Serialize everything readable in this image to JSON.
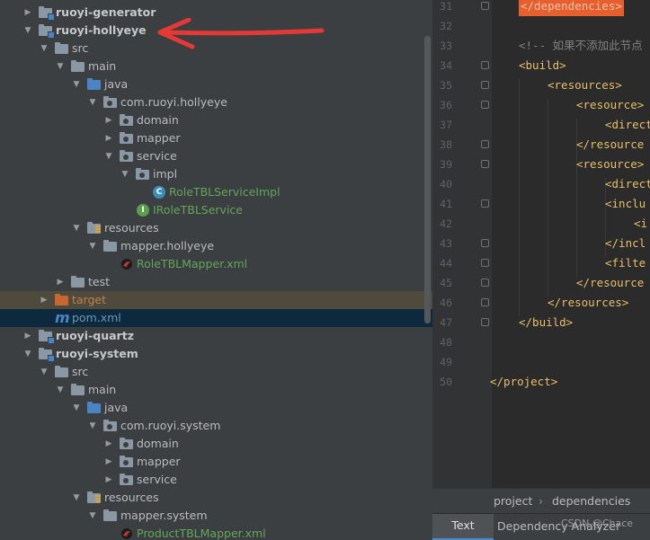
{
  "tree": {
    "rows": [
      {
        "label": "ruoyi-generator",
        "bold": true
      },
      {
        "label": "ruoyi-hollyeye",
        "bold": true
      },
      {
        "label": "src"
      },
      {
        "label": "main"
      },
      {
        "label": "java"
      },
      {
        "label": "com.ruoyi.hollyeye"
      },
      {
        "label": "domain"
      },
      {
        "label": "mapper"
      },
      {
        "label": "service"
      },
      {
        "label": "impl"
      },
      {
        "label": "RoleTBLServiceImpl"
      },
      {
        "label": "IRoleTBLService"
      },
      {
        "label": "resources"
      },
      {
        "label": "mapper.hollyeye"
      },
      {
        "label": "RoleTBLMapper.xml"
      },
      {
        "label": "test"
      },
      {
        "label": "target"
      },
      {
        "label": "pom.xml"
      },
      {
        "label": "ruoyi-quartz",
        "bold": true
      },
      {
        "label": "ruoyi-system",
        "bold": true
      },
      {
        "label": "src"
      },
      {
        "label": "main"
      },
      {
        "label": "java"
      },
      {
        "label": "com.ruoyi.system"
      },
      {
        "label": "domain"
      },
      {
        "label": "mapper"
      },
      {
        "label": "service"
      },
      {
        "label": "resources"
      },
      {
        "label": "mapper.system"
      },
      {
        "label": "ProductTBLMapper.xml"
      }
    ]
  },
  "editor": {
    "lines": [
      {
        "num": "31",
        "text": "</dependencies>"
      },
      {
        "num": "32",
        "text": ""
      },
      {
        "num": "33",
        "text": "<!-- 如果不添加此节点"
      },
      {
        "num": "34",
        "text": "<build>"
      },
      {
        "num": "35",
        "text": "<resources>"
      },
      {
        "num": "36",
        "text": "<resource>"
      },
      {
        "num": "37",
        "text": "<direct"
      },
      {
        "num": "38",
        "text": "</resource"
      },
      {
        "num": "39",
        "text": "<resource>"
      },
      {
        "num": "40",
        "text": "<direct"
      },
      {
        "num": "41",
        "text": "<inclu"
      },
      {
        "num": "42",
        "text": "<i"
      },
      {
        "num": "43",
        "text": "</incl"
      },
      {
        "num": "44",
        "text": "<filte"
      },
      {
        "num": "45",
        "text": "</resource"
      },
      {
        "num": "46",
        "text": "</resources>"
      },
      {
        "num": "47",
        "text": "</build>"
      },
      {
        "num": "48",
        "text": ""
      },
      {
        "num": "49",
        "text": ""
      },
      {
        "num": "50",
        "text": "</project>"
      }
    ]
  },
  "breadcrumb": {
    "first": "project",
    "second": "dependencies"
  },
  "bottom_tabs": {
    "text": "Text",
    "dependency": "Dependency Analyzer"
  },
  "watermark": "CSDN @Chace",
  "colors": {
    "accent": "#4a88c7",
    "highlight": "#e75f2d",
    "annotation": "#e53935"
  }
}
